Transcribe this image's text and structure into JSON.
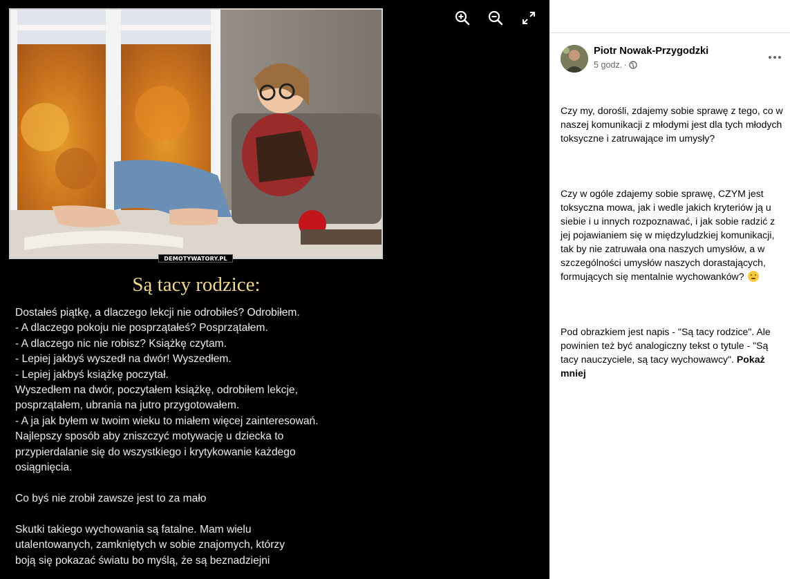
{
  "viewer": {
    "watermark": "DEMOTYWATORY.PL",
    "title": "Są tacy rodzice:",
    "body": "Dostałeś piątkę, a dlaczego lekcji nie odrobiłeś? Odrobiłem.\n- A dlaczego pokoju nie posprzątałeś? Posprzątałem.\n- A dlaczego nic nie robisz? Książkę czytam.\n- Lepiej jakbyś wyszedł na dwór! Wyszedłem.\n- Lepiej jakbyś książkę poczytał.\nWyszedłem na dwór, poczytałem książkę, odrobiłem lekcje,\nposprzątałem, ubrania na jutro przygotowałem.\n- A ja jak byłem w twoim wieku to miałem więcej zainteresowań.\nNajlepszy sposób aby zniszczyć motywację u dziecka to\nprzypierdalanie się do wszystkiego i krytykowanie każdego\nosiągnięcia.\n\nCo byś nie zrobił zawsze jest to za mało\n\nSkutki takiego wychowania są fatalne. Mam wielu\nutalentowanych, zamkniętych w sobie znajomych, którzy\nboją się pokazać światu bo myślą, że są beznadziejni",
    "controls": {
      "zoom_in_icon": "zoom-in-icon",
      "zoom_out_icon": "zoom-out-icon",
      "fullscreen_icon": "fullscreen-icon"
    }
  },
  "post": {
    "author": "Piotr Nowak-Przygodzki",
    "time": "5 godz.",
    "separator": "·",
    "privacy_icon": "globe-icon",
    "more_icon": "more-horizontal-icon",
    "paragraphs": [
      "Czy my, dorośli, zdajemy sobie sprawę z tego, co w naszej komunikacji z młodymi jest dla tych młodych toksyczne i zatruwające im umysły?",
      "Czy w ogóle zdajemy sobie sprawę, CZYM jest toksyczna mowa, jak i wedle jakich kryteriów ją u siebie i u innych rozpoznawać, i jak sobie radzić z jej pojawianiem się w międzyludzkiej komunikacji, tak by nie zatruwała ona naszych umysłów, a w szczególności umysłów naszych dorastających, formujących się mentalnie wychowanków?",
      "Pod obrazkiem jest napis - \"Są tacy rodzice\". Ale powinien też być analogiczny tekst o tytule - \"Są tacy nauczyciele, są tacy wychowawcy\"."
    ],
    "emoji": "thinking-face-emoji",
    "show_less": "Pokaż mniej"
  },
  "colors": {
    "viewer_bg": "#000000",
    "title_gold": "#f0d890",
    "panel_bg": "#ffffff",
    "meta_gray": "#65676b"
  }
}
